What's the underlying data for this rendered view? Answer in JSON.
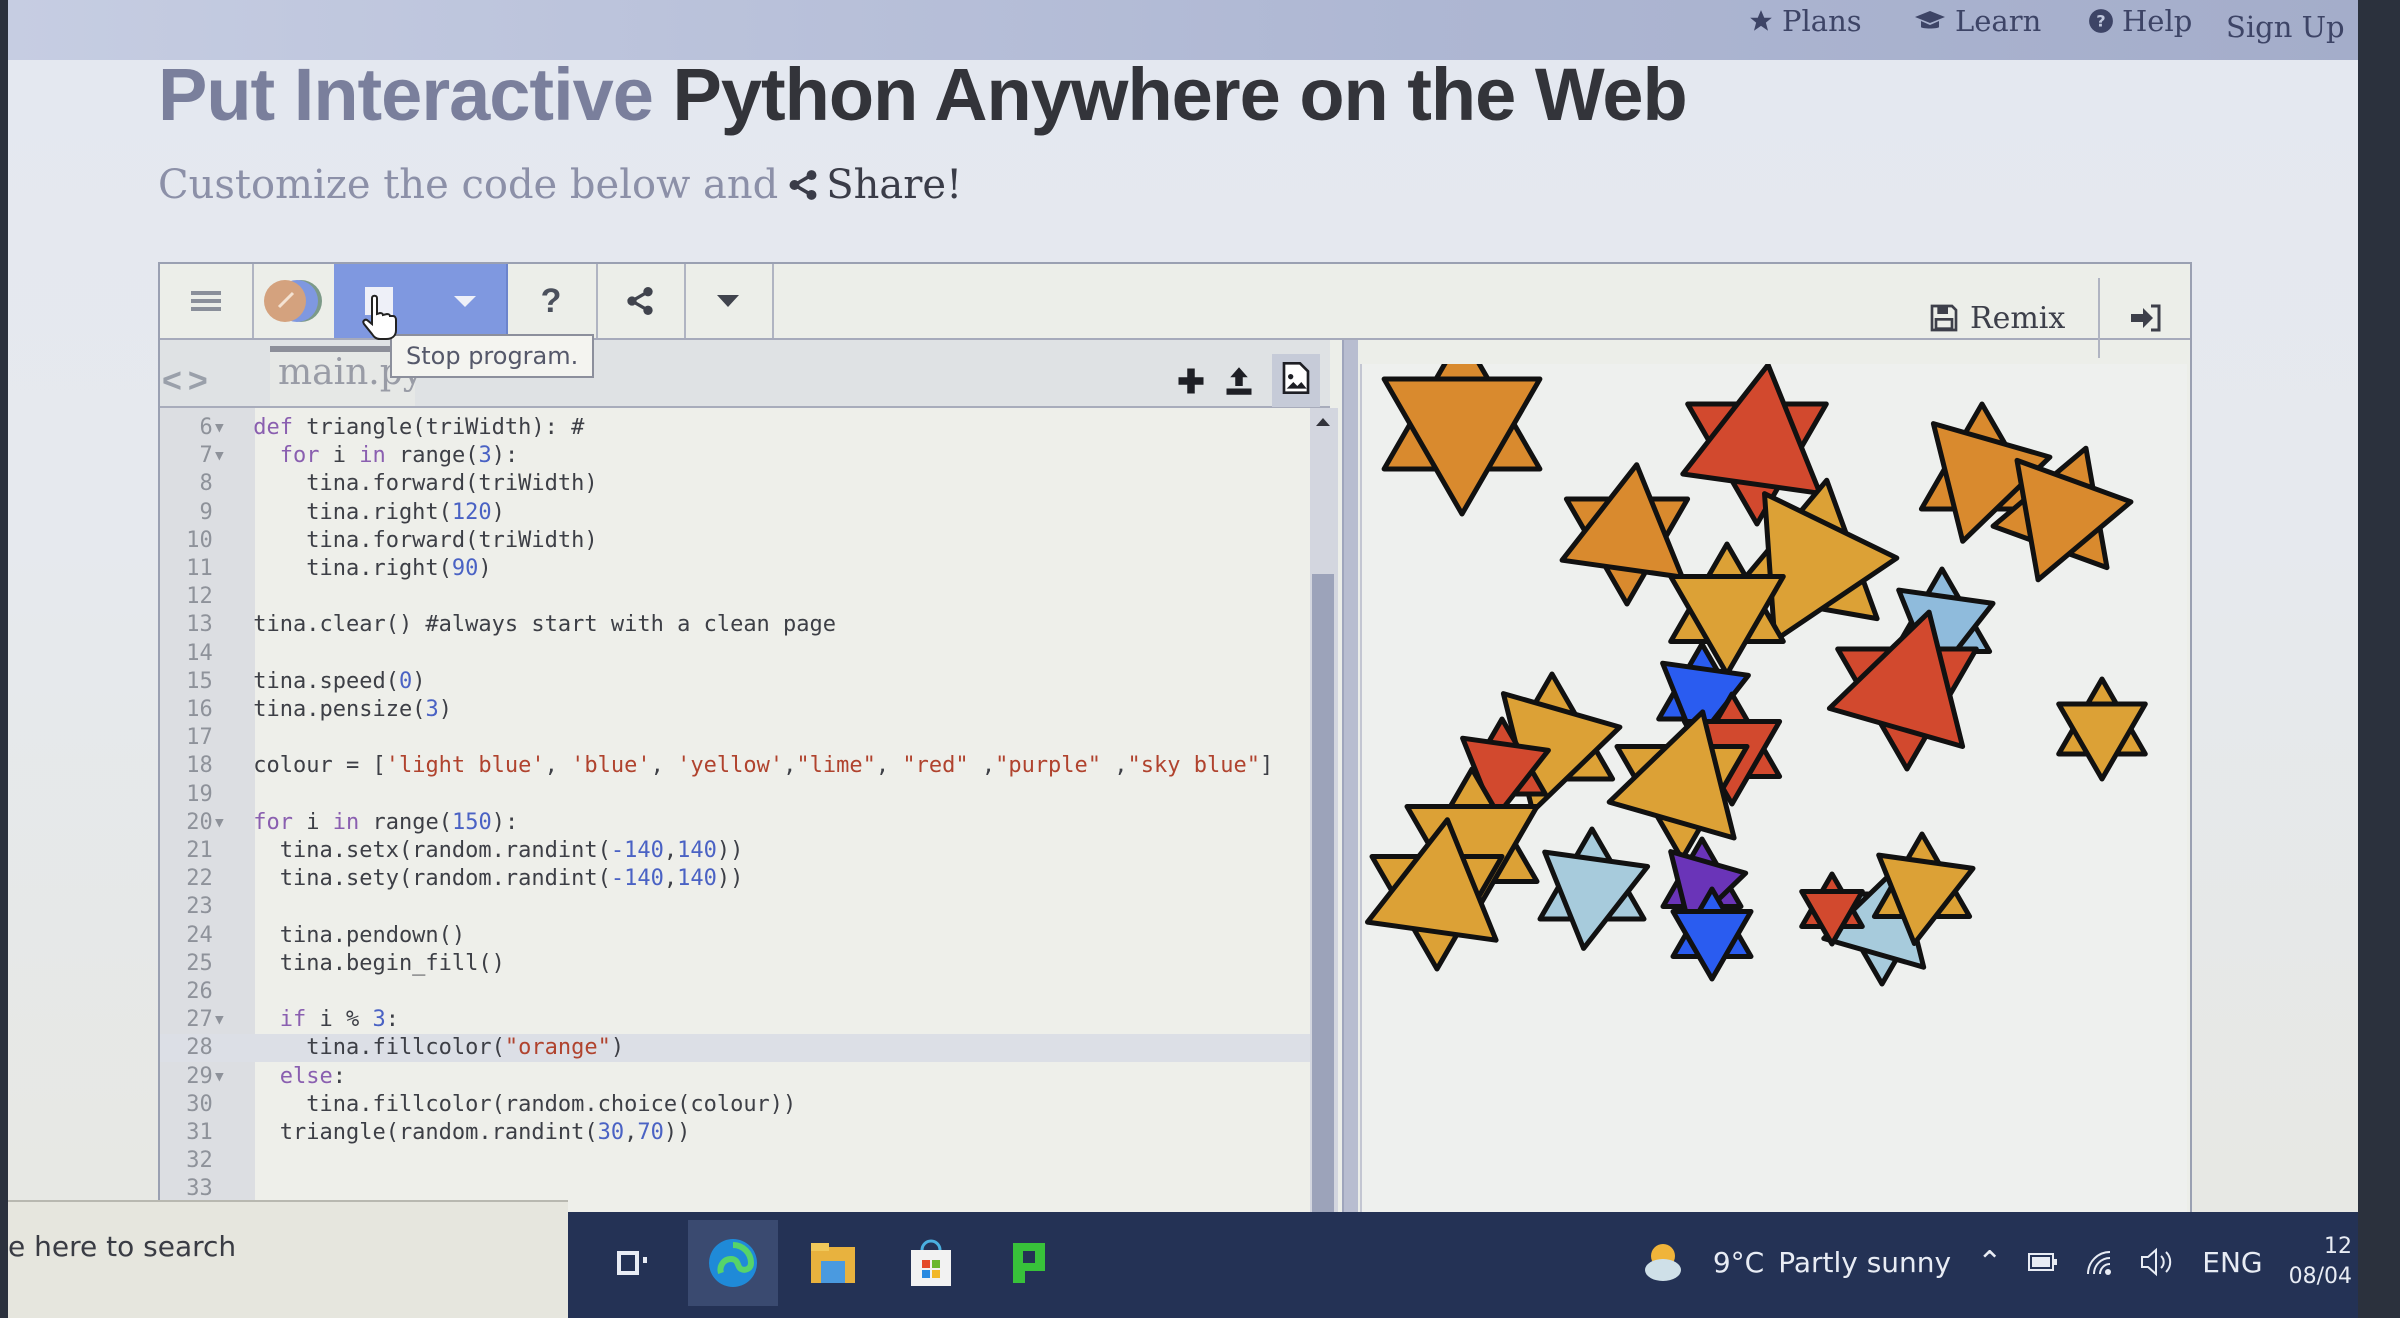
{
  "nav": {
    "items": [
      {
        "label": "Plans",
        "icon": "star-icon"
      },
      {
        "label": "Learn",
        "icon": "graduation-cap-icon"
      },
      {
        "label": "Help",
        "icon": "question-circle-icon"
      },
      {
        "label": "Sign Up",
        "icon": ""
      }
    ]
  },
  "hero": {
    "title_part1": "Put Interactive ",
    "title_part2": "Python Anywhere on the Web",
    "subtitle": "Customize the code below and",
    "share_label": "Share!"
  },
  "toolbar": {
    "menu_icon": "hamburger-icon",
    "run_icon": "run-toggle-icon",
    "stop_icon": "stop-icon",
    "dropdown_icon": "caret-down-icon",
    "help_label": "?",
    "share_icon": "share-icon",
    "more_icon": "caret-down-icon",
    "tooltip": "Stop program.",
    "remix_label": "Remix",
    "login_icon": "sign-in-icon"
  },
  "file": {
    "tab_name": "main.py",
    "actions": [
      "plus-icon",
      "upload-icon",
      "image-file-icon"
    ]
  },
  "code": {
    "lines": [
      {
        "n": "6",
        "fold": true,
        "html": "<span class='kw'>def</span> triangle(triWidth): #"
      },
      {
        "n": "7",
        "fold": true,
        "html": "  <span class='kw'>for</span> i <span class='kw'>in</span> range(<span class='numlit'>3</span>):"
      },
      {
        "n": "8",
        "fold": false,
        "html": "    tina.forward(triWidth)"
      },
      {
        "n": "9",
        "fold": false,
        "html": "    tina.right(<span class='numlit'>120</span>)"
      },
      {
        "n": "10",
        "fold": false,
        "html": "    tina.forward(triWidth)"
      },
      {
        "n": "11",
        "fold": false,
        "html": "    tina.right(<span class='numlit'>90</span>)"
      },
      {
        "n": "12",
        "fold": false,
        "html": ""
      },
      {
        "n": "13",
        "fold": false,
        "html": "tina.clear() #always start with a clean page"
      },
      {
        "n": "14",
        "fold": false,
        "html": ""
      },
      {
        "n": "15",
        "fold": false,
        "html": "tina.speed(<span class='numlit'>0</span>)"
      },
      {
        "n": "16",
        "fold": false,
        "html": "tina.pensize(<span class='numlit'>3</span>)"
      },
      {
        "n": "17",
        "fold": false,
        "html": ""
      },
      {
        "n": "18",
        "fold": false,
        "html": "colour = [<span class='str'>'light blue'</span>, <span class='str'>'blue'</span>, <span class='str'>'yellow'</span>,<span class='str'>\"lime\"</span>, <span class='str'>\"red\"</span> ,<span class='str'>\"purple\"</span> ,<span class='str'>\"sky blue\"</span>]"
      },
      {
        "n": "19",
        "fold": false,
        "html": ""
      },
      {
        "n": "20",
        "fold": true,
        "html": "<span class='kw'>for</span> i <span class='kw'>in</span> range(<span class='numlit'>150</span>):"
      },
      {
        "n": "21",
        "fold": false,
        "html": "  tina.setx(random.randint(<span class='numlit'>-140</span>,<span class='numlit'>140</span>))"
      },
      {
        "n": "22",
        "fold": false,
        "html": "  tina.sety(random.randint(<span class='numlit'>-140</span>,<span class='numlit'>140</span>))"
      },
      {
        "n": "23",
        "fold": false,
        "html": ""
      },
      {
        "n": "24",
        "fold": false,
        "html": "  tina.pendown()"
      },
      {
        "n": "25",
        "fold": false,
        "html": "  tina.begin_fill()"
      },
      {
        "n": "26",
        "fold": false,
        "html": ""
      },
      {
        "n": "27",
        "fold": true,
        "html": "  <span class='kw'>if</span> i % <span class='numlit'>3</span>:"
      },
      {
        "n": "28",
        "fold": false,
        "active": true,
        "html": "    tina.fillcolor(<span class='str'>\"orange\"</span>)"
      },
      {
        "n": "29",
        "fold": true,
        "html": "  <span class='kw'>else</span>:"
      },
      {
        "n": "30",
        "fold": false,
        "html": "    tina.fillcolor(random.choice(colour))"
      },
      {
        "n": "31",
        "fold": false,
        "html": "  triangle(random.randint(<span class='numlit'>30</span>,<span class='numlit'>70</span>))"
      },
      {
        "n": "32",
        "fold": false,
        "html": ""
      },
      {
        "n": "33",
        "fold": false,
        "html": ""
      }
    ]
  },
  "canvas": {
    "colors": {
      "orange": "#d98a2e",
      "gold": "#dca136",
      "red": "#d2492e",
      "lightblue": "#a7cbdc",
      "skyblue": "#8fbbdc",
      "blue": "#2a5cf0",
      "purple": "#6a34b8",
      "outline": "#111111"
    }
  },
  "taskbar": {
    "search_placeholder": "e here to search",
    "apps": [
      "task-view-icon",
      "edge-icon",
      "file-explorer-icon",
      "store-icon",
      "app-icon"
    ],
    "weather_temp": "9°C",
    "weather_desc": "Partly sunny",
    "language": "ENG",
    "time": "12",
    "date": "08/04"
  }
}
